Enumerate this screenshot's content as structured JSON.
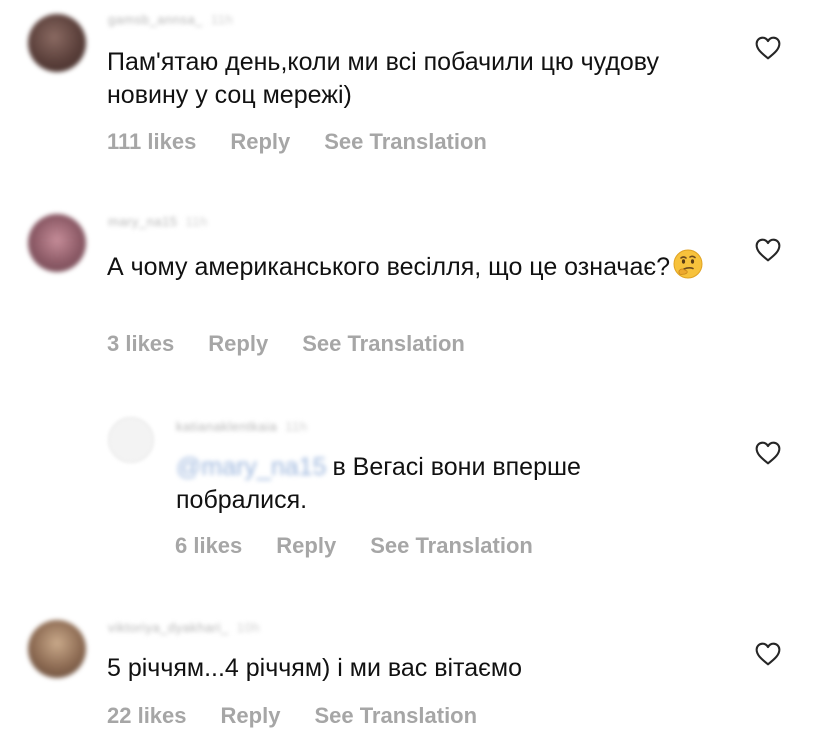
{
  "comments": [
    {
      "username": "gamsb_annsa_",
      "time": "11h",
      "text": "Пам'ятаю день,коли ми всі побачили цю чудову новину у соц мережі)",
      "likes": "111 likes",
      "reply": "Reply",
      "translate": "See Translation"
    },
    {
      "username": "mary_na15",
      "time": "11h",
      "text": "А чому американського весілля, що це означає?",
      "emoji": "thinking-face",
      "likes": "3 likes",
      "reply": "Reply",
      "translate": "See Translation"
    },
    {
      "username": "katianaklentkaia",
      "time": "11h",
      "mention": "@mary_na15",
      "text": "в Вегасі вони вперше побралися.",
      "likes": "6 likes",
      "reply": "Reply",
      "translate": "See Translation"
    },
    {
      "username": "viktoriya_dyakhari_",
      "time": "10h",
      "text": "5 річчям...4 річчям) і ми вас вітаємо",
      "likes": "22 likes",
      "reply": "Reply",
      "translate": "See Translation"
    }
  ],
  "icons": {
    "like": "heart-outline-icon",
    "emoji": "thinking-face"
  },
  "colors": {
    "text": "#111111",
    "meta": "#a6a6a6",
    "username_blurred": "#b5b5b5",
    "mention_blurred": "#9cb6dd"
  }
}
